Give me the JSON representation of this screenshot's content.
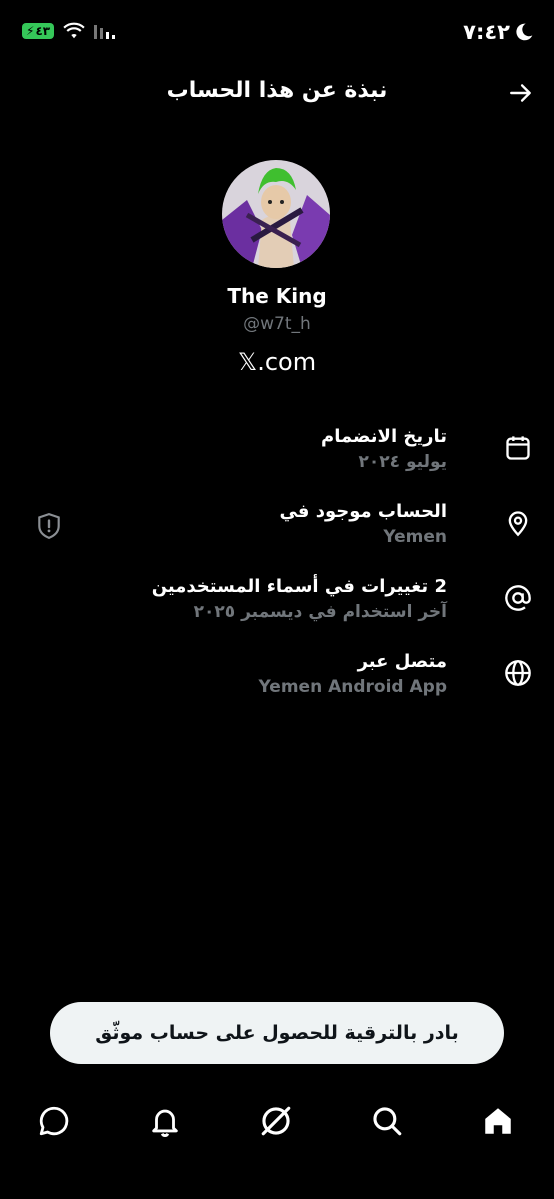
{
  "status_bar": {
    "time": "٧:٤٢",
    "battery": "٤٣",
    "moon_icon": "moon-icon",
    "wifi_icon": "wifi-icon",
    "signal_icon": "signal-icon"
  },
  "header": {
    "title": "نبذة عن هذا الحساب",
    "back_icon": "arrow-right-icon"
  },
  "profile": {
    "display_name": "The King",
    "handle": "@w7t_h",
    "site": "𝕏.com"
  },
  "info_rows": [
    {
      "icon": "calendar-icon",
      "title": "تاريخ الانضمام",
      "subtitle": "يوليو ٢٠٢٤"
    },
    {
      "icon": "location-pin-icon",
      "title": "الحساب موجود في",
      "subtitle": "Yemen"
    },
    {
      "icon": "at-sign-icon",
      "title": "2 تغييرات في أسماء المستخدمين",
      "subtitle": "آخر استخدام في ديسمبر ٢٠٢٥"
    },
    {
      "icon": "globe-icon",
      "title": "متصل عبر",
      "subtitle": "Yemen Android App"
    }
  ],
  "upgrade_button": {
    "label": "بادر بالترقية للحصول على حساب موثّق"
  },
  "bottom_nav": [
    {
      "name": "home",
      "icon": "home-icon",
      "active": true
    },
    {
      "name": "search",
      "icon": "search-icon",
      "active": false
    },
    {
      "name": "grok",
      "icon": "grok-icon",
      "active": false
    },
    {
      "name": "notifications",
      "icon": "bell-icon",
      "active": false
    },
    {
      "name": "messages",
      "icon": "message-icon",
      "active": false
    }
  ],
  "colors": {
    "background": "#000000",
    "primary_text": "#ffffff",
    "secondary_text": "#71767b",
    "battery_green": "#35c759",
    "button_bg": "#eff3f4"
  }
}
